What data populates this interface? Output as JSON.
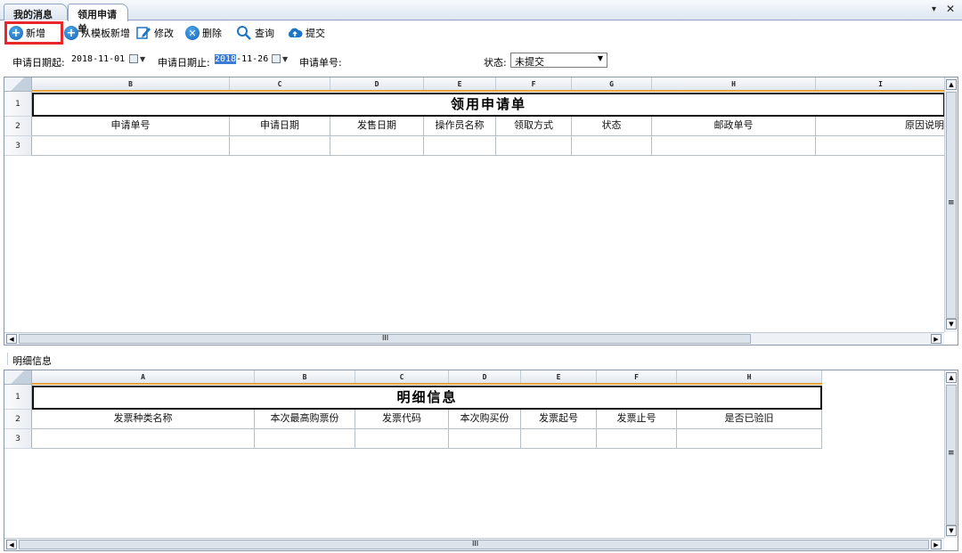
{
  "tabs": [
    "我的消息",
    "领用申请单"
  ],
  "tab_controls": {
    "dropdown": "▾",
    "close": "✕"
  },
  "toolbar": {
    "add": "新增",
    "add_from_template": "从模板新增",
    "edit": "修改",
    "delete": "删除",
    "query": "查询",
    "submit": "提交"
  },
  "filters": {
    "date_from_label": "申请日期起:",
    "date_from_value": "2018-11-01",
    "date_to_label": "申请日期止:",
    "date_to_value_selected": "2018",
    "date_to_value_rest": "-11-26",
    "apply_no_label": "申请单号:",
    "status_label": "状态:",
    "status_value": "未提交"
  },
  "grid1": {
    "col_letters": [
      "B",
      "C",
      "D",
      "E",
      "F",
      "G",
      "H",
      "I"
    ],
    "row_numbers": [
      "1",
      "2",
      "3"
    ],
    "title": "领用申请单",
    "headers": [
      "申请单号",
      "申请日期",
      "发售日期",
      "操作员名称",
      "领取方式",
      "状态",
      "邮政单号",
      "原因说明"
    ]
  },
  "section_label": "明细信息",
  "grid2": {
    "col_letters": [
      "A",
      "B",
      "C",
      "D",
      "E",
      "F",
      "H"
    ],
    "row_numbers": [
      "1",
      "2",
      "3"
    ],
    "title": "明细信息",
    "headers": [
      "发票种类名称",
      "本次最高购票份",
      "发票代码",
      "本次购买份",
      "发票起号",
      "发票止号",
      "是否已验旧"
    ]
  },
  "scroll": {
    "grip": "III",
    "vgrip": "≡"
  },
  "colors": {
    "accent_red": "#e8262b",
    "header_orange": "#e8a33d",
    "icon_blue": "#1e74c6"
  }
}
